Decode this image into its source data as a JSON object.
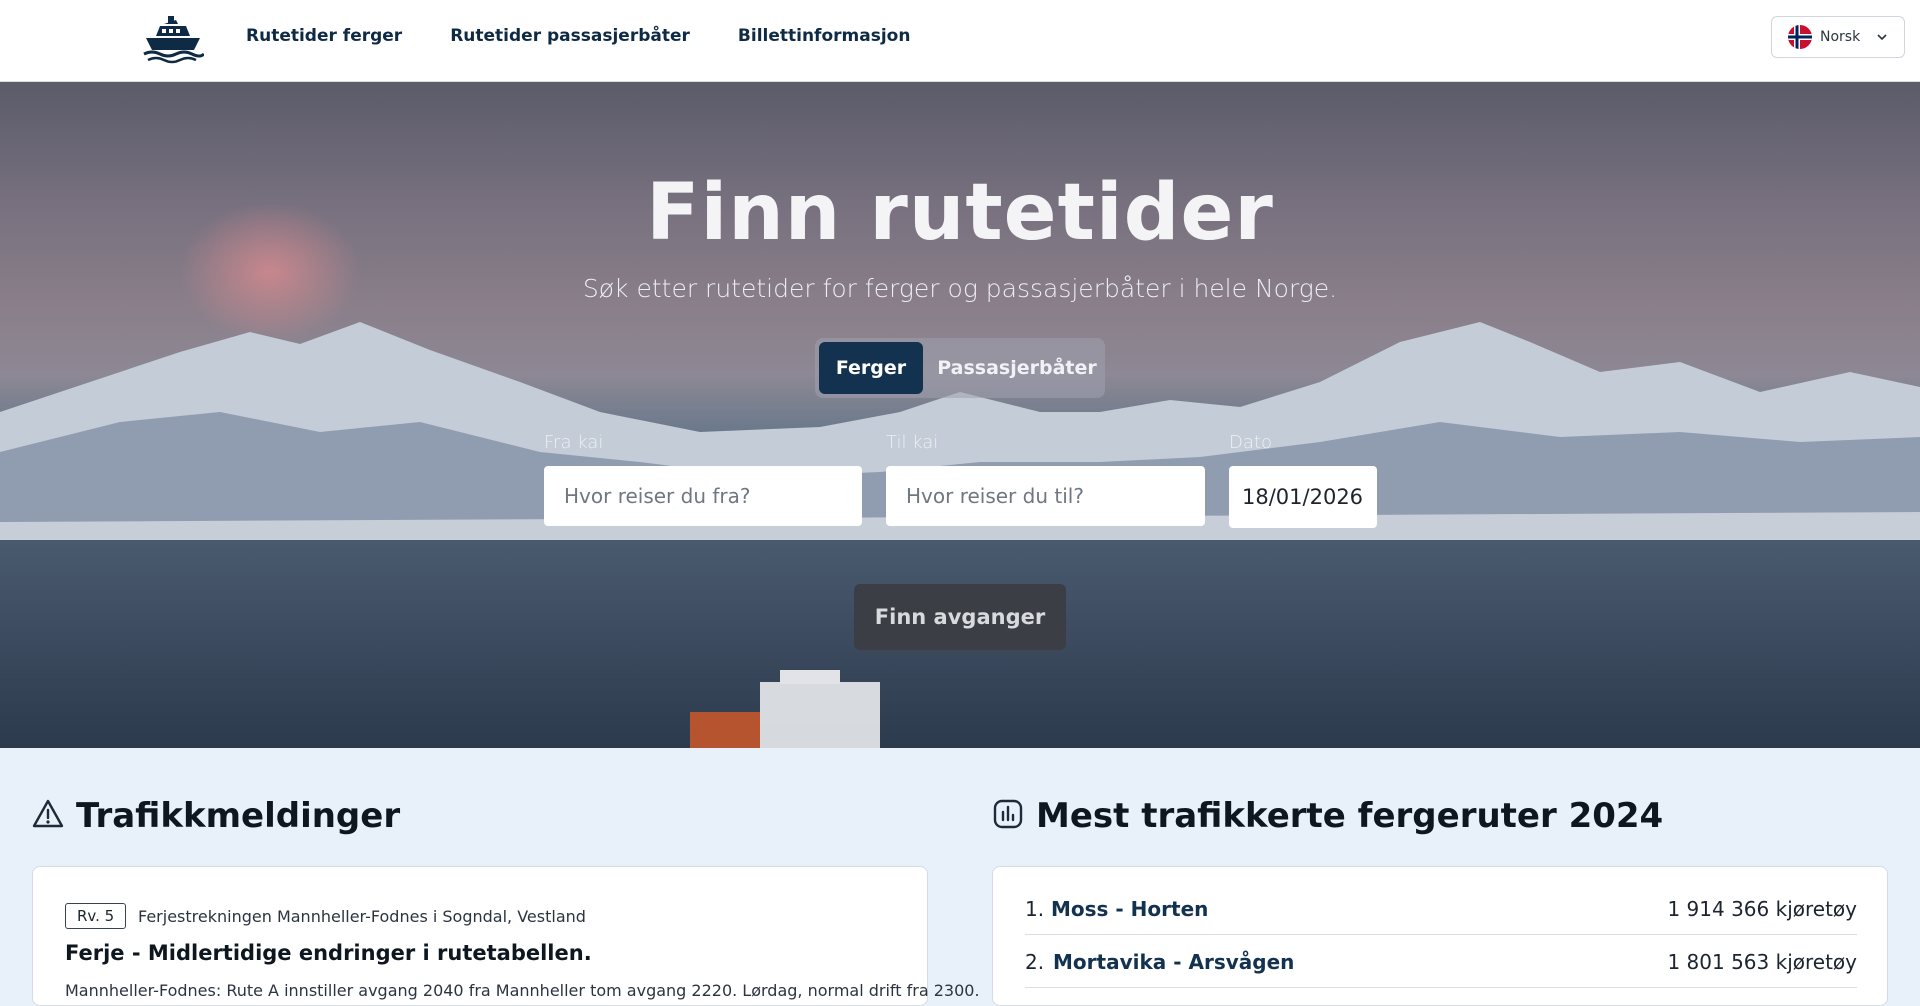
{
  "header": {
    "nav": [
      "Rutetider ferger",
      "Rutetider passasjerbåter",
      "Billettinformasjon"
    ],
    "language": "Norsk"
  },
  "hero": {
    "title": "Finn rutetider",
    "subtitle": "Søk etter rutetider for ferger og passasjerbåter i hele Norge.",
    "tabs": [
      "Ferger",
      "Passasjerbåter"
    ],
    "active_tab": "Ferger",
    "from": {
      "label": "Fra kai",
      "placeholder": "Hvor reiser du fra?",
      "value": ""
    },
    "to": {
      "label": "Til kai",
      "placeholder": "Hvor reiser du til?",
      "value": ""
    },
    "date": {
      "label": "Dato",
      "value": "18/01/2026"
    },
    "button": "Finn avganger"
  },
  "traffic": {
    "title": "Trafikkmeldinger",
    "items": [
      {
        "tag": "Rv. 5",
        "location": "Ferjestrekningen Mannheller-Fodnes i Sogndal, Vestland",
        "title": "Ferje - Midlertidige endringer i rutetabellen.",
        "body": "Mannheller-Fodnes: Rute A innstiller avgang 2040 fra Mannheller tom avgang 2220. Lørdag, normal drift fra 2300."
      }
    ]
  },
  "top_routes": {
    "title": "Mest trafikkerte fergeruter 2024",
    "items": [
      {
        "rank": "1.",
        "name": "Moss - Horten",
        "count": "1 914 366 kjøretøy"
      },
      {
        "rank": "2.",
        "name": "Mortavika - Arsvågen",
        "count": "1 801 563 kjøretøy"
      }
    ]
  },
  "colors": {
    "header_bg": "#ffffff",
    "nav_text": "#0f2a44",
    "active_tab": "#12324f",
    "section_bg": "#e8f1fa",
    "button_bg": "#3b3e44"
  },
  "icons": [
    "ferry-logo-icon",
    "norway-flag-icon",
    "chevron-down-icon",
    "warning-icon",
    "chart-icon"
  ]
}
